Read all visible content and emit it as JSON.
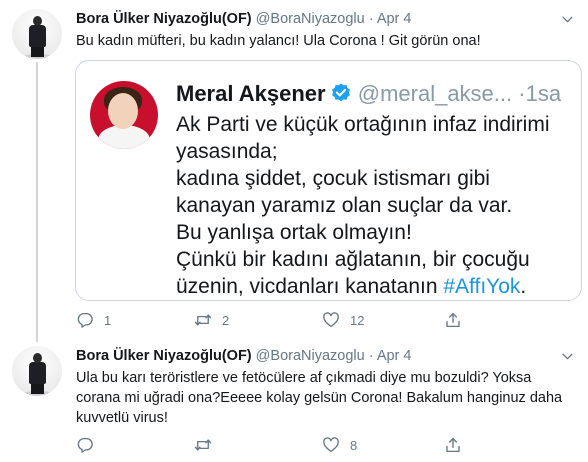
{
  "tweets": [
    {
      "name": "Bora Ülker Niyazoğlu(OF)",
      "handle": "@BoraNiyazoglu",
      "separator": "·",
      "date": "Apr 4",
      "text": "Bu kadın müfteri, bu kadın yalancı! Ula Corona ! Git görün ona!",
      "quoted": {
        "name": "Meral Akşener",
        "handle": "@meral_akse...",
        "separator": "·",
        "time": "1sa",
        "lines": [
          "Ak Parti ve küçük ortağının infaz indirimi",
          "yasasında;",
          "kadına şiddet, çocuk istismarı gibi",
          "kanayan yaramız olan suçlar da var.",
          "Bu yanlışa ortak olmayın!",
          "Çünkü bir kadını ağlatanın, bir çocuğu"
        ],
        "last_line_text": "üzenin, vicdanları kanatanın ",
        "hashtag": "#AffıYok",
        "last_line_end": "."
      },
      "actions": {
        "reply_count": "1",
        "retweet_count": "2",
        "like_count": "12"
      }
    },
    {
      "name": "Bora Ülker Niyazoğlu(OF)",
      "handle": "@BoraNiyazoglu",
      "separator": "·",
      "date": "Apr 4",
      "text_lines": [
        "Ula bu karı teröristlere ve fetöcülere af çıkmadi diye mu bozuldi? Yoksa",
        "corana mi uğradi ona?Eeeee kolay gelsün Corona! Bakalum hanginuz daha",
        "kuvvetlü virus!"
      ],
      "actions": {
        "reply_count": "",
        "retweet_count": "",
        "like_count": "8"
      }
    }
  ],
  "icons": {
    "reply": "reply-icon",
    "retweet": "retweet-icon",
    "like": "like-icon",
    "share": "share-icon",
    "caret": "chevron-down-icon",
    "verified": "verified-badge-icon"
  },
  "colors": {
    "text_primary": "#14171a",
    "text_secondary": "#657786",
    "border": "#ccd6dd",
    "link": "#1b95e0",
    "verified": "#1da1f2"
  }
}
